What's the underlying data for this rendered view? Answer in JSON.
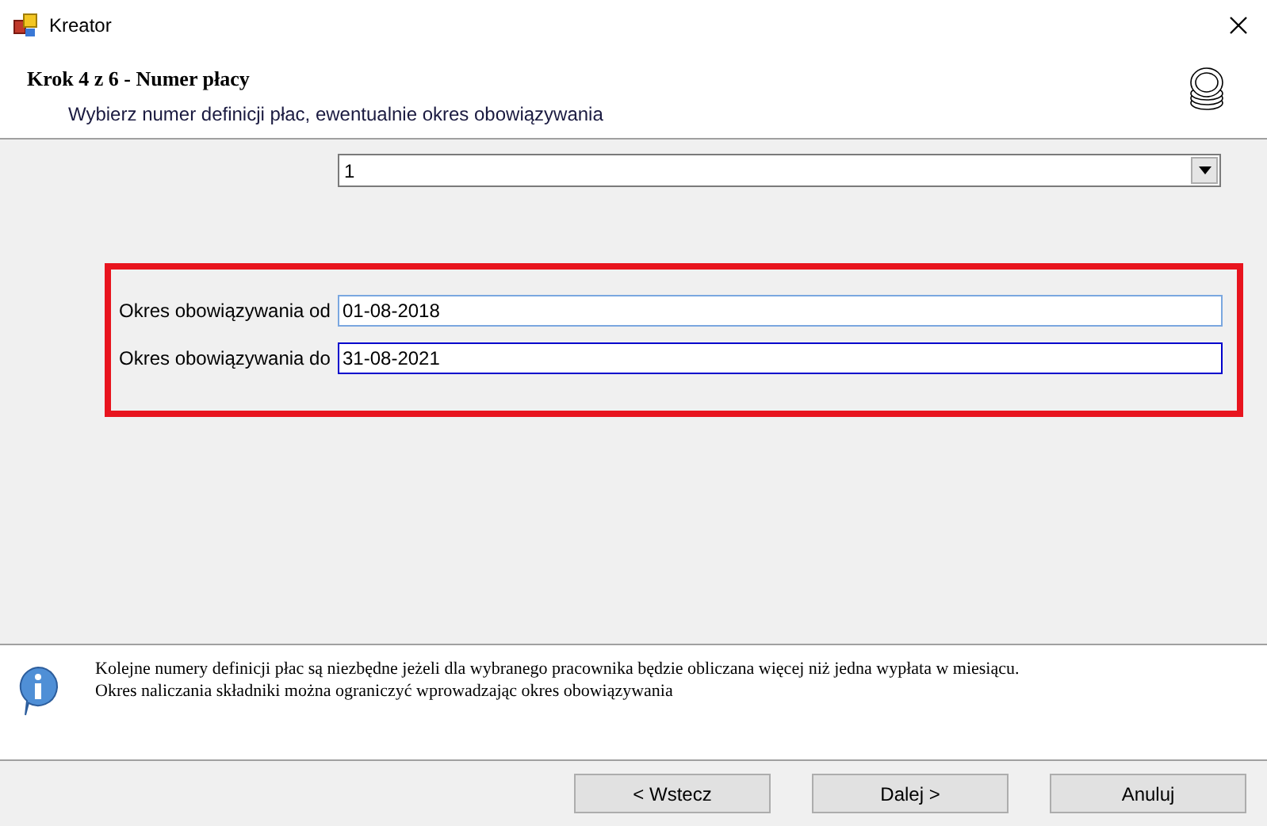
{
  "window": {
    "title": "Kreator"
  },
  "header": {
    "title": "Krok 4 z 6 - Numer płacy",
    "subtitle": "Wybierz numer definicji płac, ewentualnie okres obowiązywania"
  },
  "dropdown": {
    "value": "1"
  },
  "highlight": {
    "on": true
  },
  "fields": [
    {
      "label": "Okres obowiązywania od",
      "value": "01-08-2018",
      "focused": false
    },
    {
      "label": "Okres obowiązywania do",
      "value": "31-08-2021",
      "focused": true
    }
  ],
  "info": [
    "Kolejne numery definicji płac są niezbędne jeżeli dla wybranego pracownika będzie obliczana więcej niż jedna wypłata w miesiącu.",
    "Okres naliczania składniki można ograniczyć wprowadzając okres obowiązywania"
  ],
  "buttons": [
    "< Wstecz",
    "Dalej >",
    "Anuluj"
  ]
}
